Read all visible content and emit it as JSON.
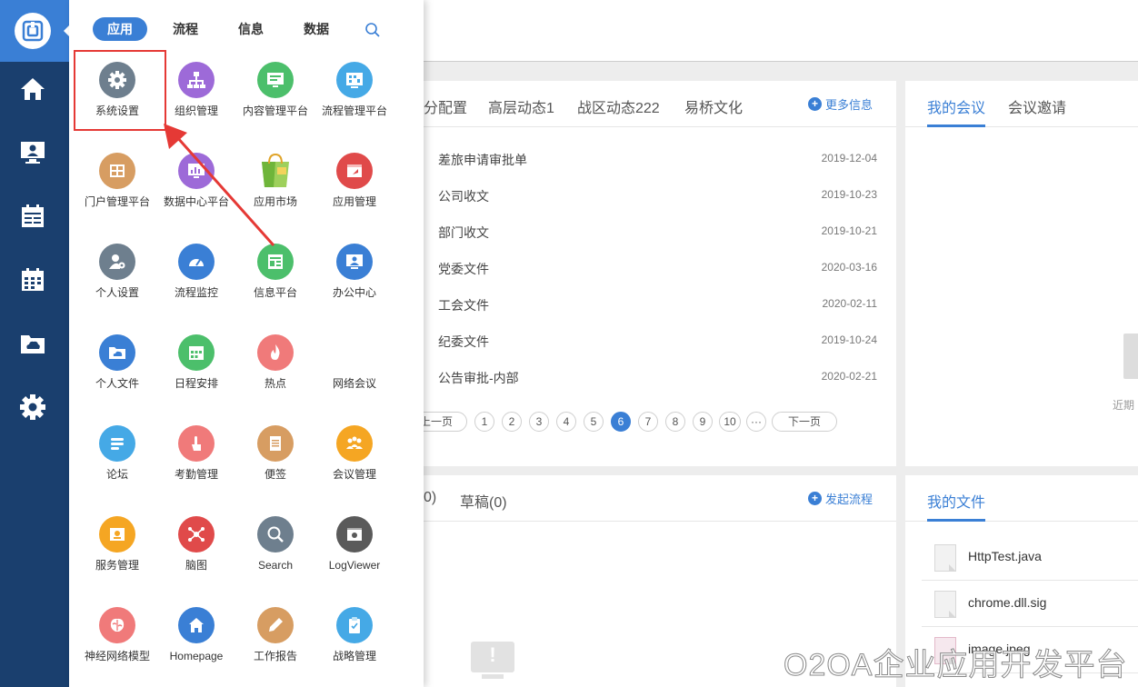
{
  "colors": {
    "brand": "#3a7fd5",
    "sidebar": "#1a3f6e",
    "highlight": "#e53935"
  },
  "sidebar": {
    "logo_icon": "o2oa-logo-icon",
    "nav": [
      {
        "icon": "home-icon"
      },
      {
        "icon": "desktop-user-icon"
      },
      {
        "icon": "calendar-list-icon"
      },
      {
        "icon": "calendar-grid-icon"
      },
      {
        "icon": "cloud-folder-icon"
      },
      {
        "icon": "gear-icon"
      }
    ]
  },
  "drawer": {
    "tabs": [
      "应用",
      "流程",
      "信息",
      "数据"
    ],
    "active_tab": "应用",
    "search_icon": "search-icon",
    "apps": [
      {
        "label": "系统设置",
        "icon": "gear-icon",
        "color": "#6e7f8e"
      },
      {
        "label": "组织管理",
        "icon": "org-chart-icon",
        "color": "#9d6ad8"
      },
      {
        "label": "内容管理平台",
        "icon": "monitor-doc-icon",
        "color": "#4cbf6b"
      },
      {
        "label": "流程管理平台",
        "icon": "flow-board-icon",
        "color": "#45a9e6"
      },
      {
        "label": "门户管理平台",
        "icon": "portal-grid-icon",
        "color": "#d79d62"
      },
      {
        "label": "数据中心平台",
        "icon": "data-monitor-icon",
        "color": "#9d6ad8"
      },
      {
        "label": "应用市场",
        "icon": "shopping-bag-icon",
        "color": "#7fbf4d"
      },
      {
        "label": "应用管理",
        "icon": "app-window-icon",
        "color": "#e04a4a"
      },
      {
        "label": "个人设置",
        "icon": "user-gear-icon",
        "color": "#6e7f8e"
      },
      {
        "label": "流程监控",
        "icon": "speedometer-icon",
        "color": "#3a7fd5"
      },
      {
        "label": "信息平台",
        "icon": "news-icon",
        "color": "#4cbf6b"
      },
      {
        "label": "办公中心",
        "icon": "office-user-icon",
        "color": "#3a7fd5"
      },
      {
        "label": "个人文件",
        "icon": "cloud-folder-icon",
        "color": "#3a7fd5"
      },
      {
        "label": "日程安排",
        "icon": "calendar-icon",
        "color": "#4cbf6b"
      },
      {
        "label": "热点",
        "icon": "fire-icon",
        "color": "#f07a7a"
      },
      {
        "label": "网络会议",
        "icon": "",
        "color": ""
      },
      {
        "label": "论坛",
        "icon": "forum-icon",
        "color": "#45a9e6"
      },
      {
        "label": "考勤管理",
        "icon": "tap-hand-icon",
        "color": "#f07a7a"
      },
      {
        "label": "便签",
        "icon": "notepad-icon",
        "color": "#d79d62"
      },
      {
        "label": "会议管理",
        "icon": "meeting-people-icon",
        "color": "#f5a623"
      },
      {
        "label": "服务管理",
        "icon": "service-icon",
        "color": "#f5a623"
      },
      {
        "label": "脑图",
        "icon": "mindmap-icon",
        "color": "#e04a4a"
      },
      {
        "label": "Search",
        "icon": "search-icon",
        "color": "#6e7f8e"
      },
      {
        "label": "LogViewer",
        "icon": "log-viewer-icon",
        "color": "#5a5a5a"
      },
      {
        "label": "神经网络模型",
        "icon": "brain-icon",
        "color": "#f07a7a"
      },
      {
        "label": "Homepage",
        "icon": "house-icon",
        "color": "#3a7fd5"
      },
      {
        "label": "工作报告",
        "icon": "pen-icon",
        "color": "#d79d62"
      },
      {
        "label": "战略管理",
        "icon": "clipboard-icon",
        "color": "#45a9e6"
      }
    ]
  },
  "notice_panel": {
    "tabs": [
      "分配置",
      "高层动态1",
      "战区动态222",
      "易桥文化"
    ],
    "more_label": "更多信息",
    "rows": [
      {
        "title": "差旅申请审批单",
        "date": "2019-12-04"
      },
      {
        "title": "公司收文",
        "date": "2019-10-23"
      },
      {
        "title": "部门收文",
        "date": "2019-10-21"
      },
      {
        "title": "党委文件",
        "date": "2020-03-16"
      },
      {
        "title": "工会文件",
        "date": "2020-02-11"
      },
      {
        "title": "纪委文件",
        "date": "2019-10-24"
      },
      {
        "title": "公告审批-内部",
        "date": "2020-02-21"
      }
    ],
    "pager": {
      "prev": "上一页",
      "pages": [
        "1",
        "2",
        "3",
        "4",
        "5",
        "6",
        "7",
        "8",
        "9",
        "10"
      ],
      "current": "6",
      "ellipsis": "···",
      "next": "下一页"
    }
  },
  "meeting_panel": {
    "tabs": [
      "我的会议",
      "会议邀请"
    ],
    "empty_hint": "近期"
  },
  "flow_panel": {
    "tabs": [
      "0)",
      "草稿(0)"
    ],
    "action_label": "发起流程"
  },
  "files_panel": {
    "title": "我的文件",
    "files": [
      "HttpTest.java",
      "chrome.dll.sig",
      "image.jpeg"
    ]
  },
  "watermark": "O2OA企业应用开发平台"
}
